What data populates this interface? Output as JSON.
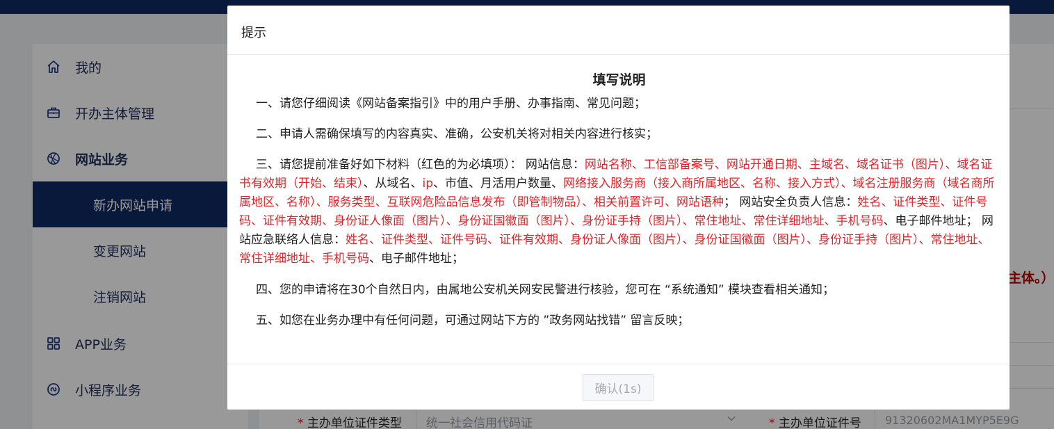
{
  "sidebar": {
    "items": [
      {
        "label": "我的",
        "icon": "home-icon"
      },
      {
        "label": "开办主体管理",
        "icon": "briefcase-icon"
      },
      {
        "label": "网站业务",
        "icon": "globe-icon"
      },
      {
        "label": "APP业务",
        "icon": "grid-icon"
      },
      {
        "label": "小程序业务",
        "icon": "miniprogram-icon"
      }
    ],
    "subitems": [
      {
        "label": "新办网站申请",
        "active": true
      },
      {
        "label": "变更网站"
      },
      {
        "label": "注销网站"
      }
    ]
  },
  "background": {
    "hint_fragment": "主体。）",
    "form": {
      "cert_type_label": "主办单位证件类型",
      "cert_type_value": "统一社会信用代码证",
      "cert_no_label": "主办单位证件号",
      "cert_no_value": "91320602MA1MYP5E9G",
      "required_mark": "*"
    }
  },
  "dialog": {
    "title": "提示",
    "doc_title": "填写说明",
    "p1": "一、请您仔细阅读《网站备案指引》中的用户手册、办事指南、常见问题；",
    "p2": "二、申请人需确保填写的内容真实、准确，公安机关将对相关内容进行核实；",
    "p3": {
      "s1": "三、请您提前准备好如下材料（红色的为必填项）： 网站信息：",
      "r1": "网站名称、工信部备案号、网站开通日期、主域名、域名证书（图片）、域名证书有效期（开始、结束）",
      "s2": "、从域名、",
      "r2": "ip",
      "s3": "、市值、月活用户数量、",
      "r3": "网络接入服务商（接入商所属地区、名称、接入方式）、域名注册服务商（域名商所属地区、名称）、服务类型、互联网危险品信息发布（即管制物品）、相关前置许可、网站语种",
      "s4": "； 网站安全负责人信息：",
      "r4": "姓名、证件类型、证件号码、证件有效期、身份证人像面（图片）、身份证国徽面（图片）、身份证手持（图片）、常住地址、常住详细地址、手机号码",
      "s5": "、电子邮件地址； 网站应急联络人信息：",
      "r5": "姓名、证件类型、证件号码、证件有效期、身份证人像面（图片）、身份证国徽面（图片）、身份证手持（图片）、常住地址、常住详细地址、手机号码",
      "s6": "、电子邮件地址；"
    },
    "p4": "四、您的申请将在30个自然日内，由属地公安机关网安民警进行核验，您可在 “系统通知” 模块查看相关通知；",
    "p5": "五、如您在业务办理中有任何问题，可通过网站下方的 ”政务网站找错” 留言反映；",
    "confirm_label": "确认(1s)"
  }
}
